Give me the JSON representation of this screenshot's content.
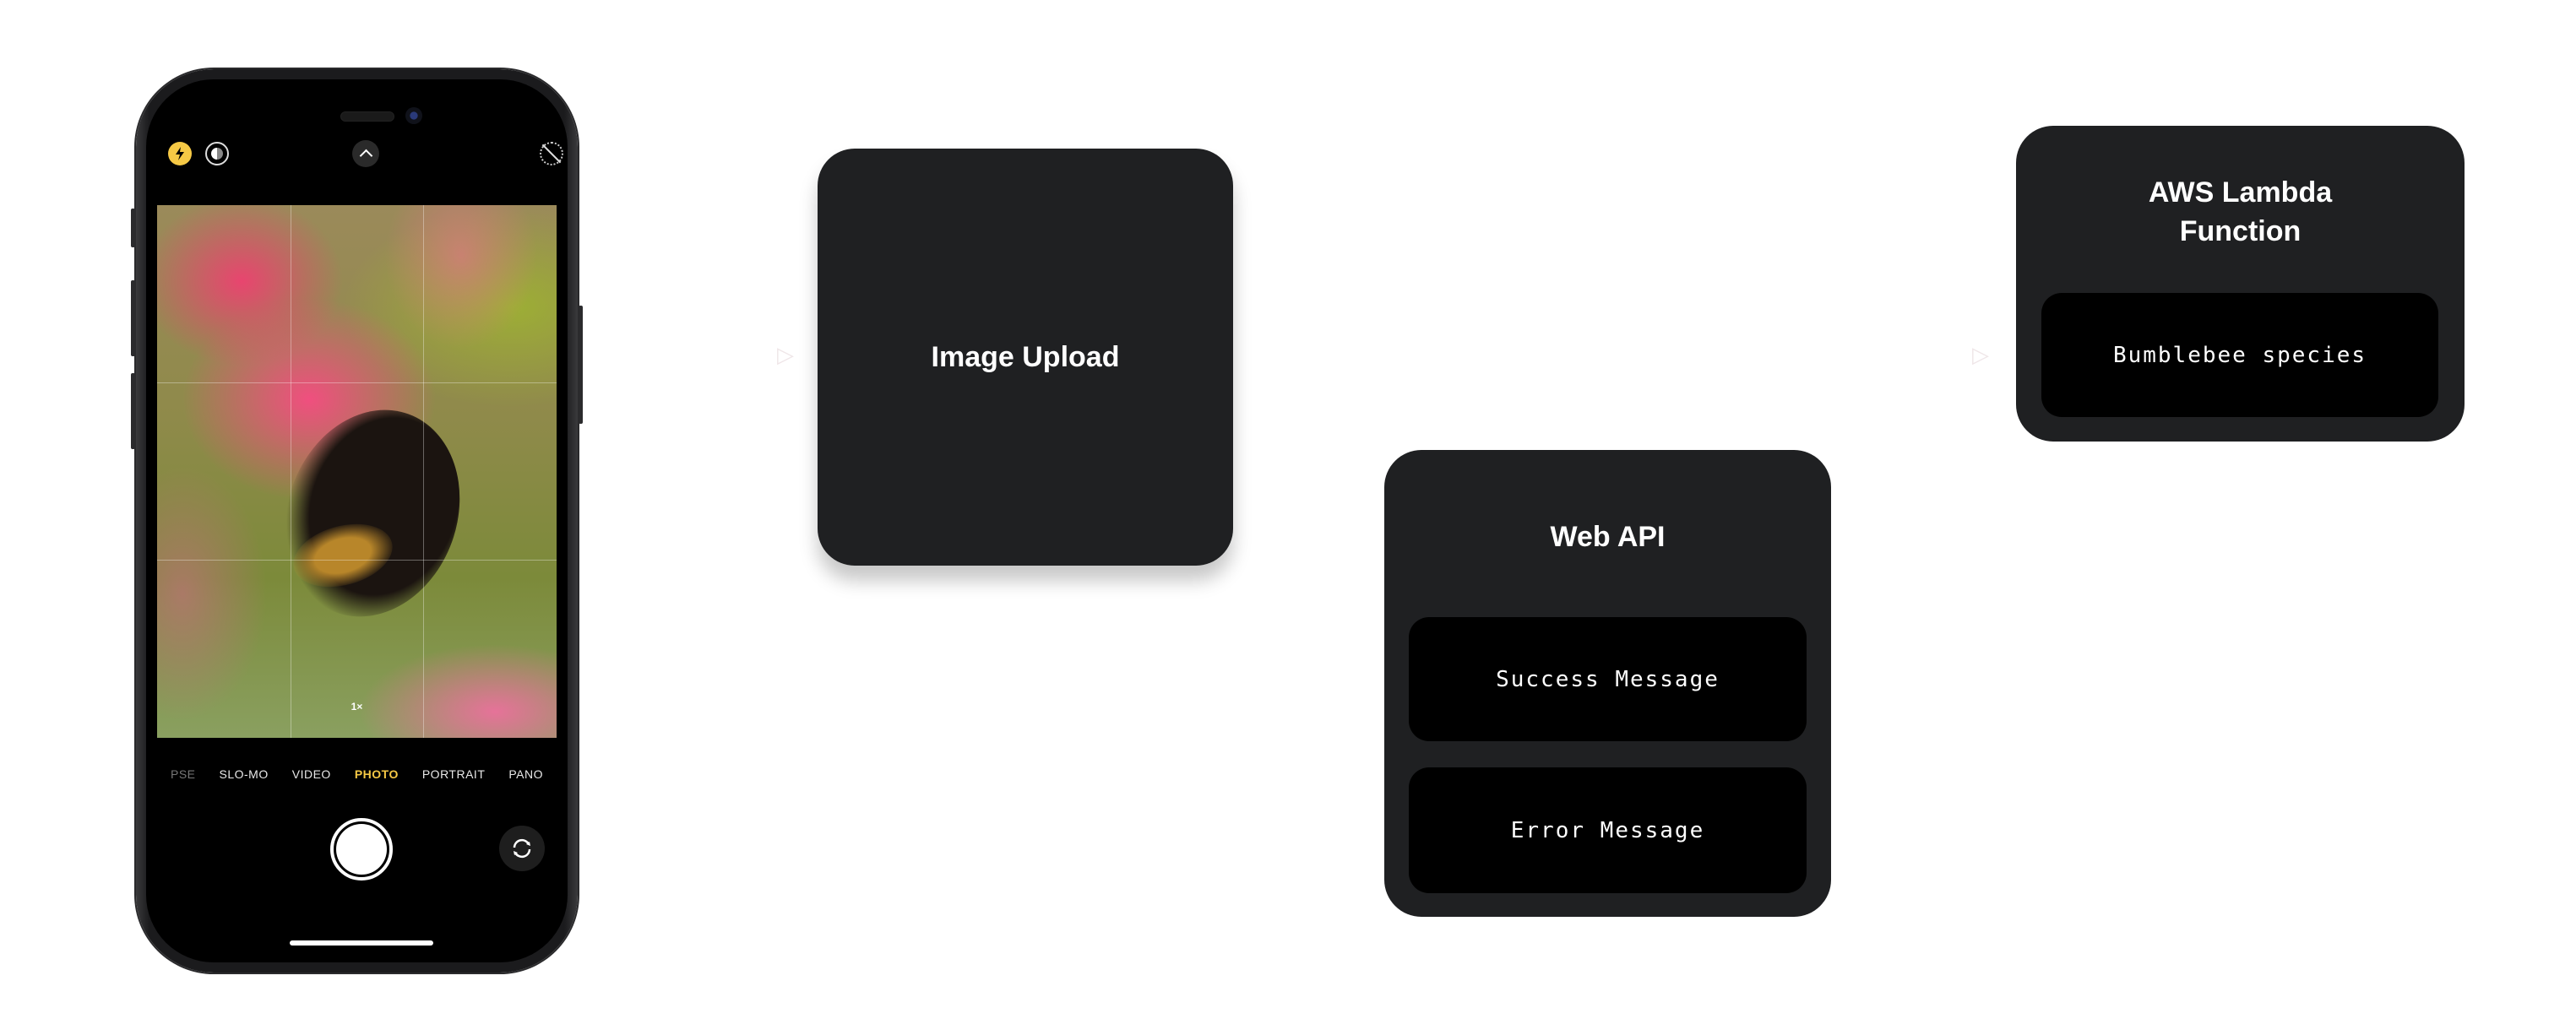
{
  "phone": {
    "camera_modes": [
      "PSE",
      "SLO-MO",
      "VIDEO",
      "PHOTO",
      "PORTRAIT",
      "PANO"
    ],
    "selected_mode": "PHOTO",
    "zoom_level": "1×",
    "icons": {
      "flash": "flash-icon",
      "live_photo": "live-photo-icon",
      "controls_toggle": "chevron-up-icon",
      "live_off": "live-photo-off-icon",
      "shutter": "shutter-button",
      "flip_camera": "camera-flip-icon"
    },
    "accent_color": "#f6c945"
  },
  "diagram": {
    "nodes": [
      {
        "id": "image-upload",
        "title": "Image Upload",
        "items": []
      },
      {
        "id": "web-api",
        "title": "Web API",
        "items": [
          "Success Message",
          "Error Message"
        ]
      },
      {
        "id": "aws-lambda",
        "title": "AWS Lambda Function",
        "items": [
          "Bumblebee species"
        ]
      }
    ],
    "card_color": "#1f2022",
    "inner_color": "#000000"
  }
}
